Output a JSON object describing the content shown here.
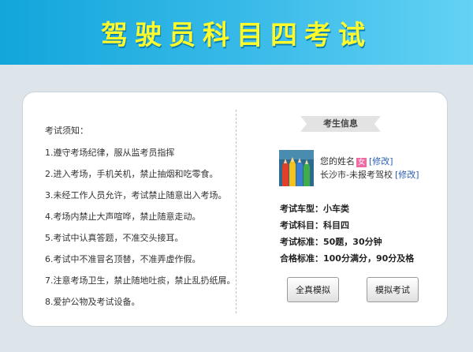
{
  "header": {
    "title": "驾驶员科目四考试"
  },
  "rules": {
    "heading": "考试须知：",
    "items": [
      "1.遵守考场纪律，服从监考员指挥",
      "2.进入考场，手机关机，禁止抽烟和吃零食。",
      "3.未经工作人员允许，考试禁止随意出入考场。",
      "4.考场内禁止大声喧哗，禁止随意走动。",
      "5.考试中认真答题，不准交头接耳。",
      "6.考试中不准冒名顶替，不准弄虚作假。",
      "7.注意考场卫生，禁止随地吐痰，禁止乱扔纸屑。",
      "8.爱护公物及考试设备。"
    ]
  },
  "info": {
    "header": "考生信息",
    "name": "您的姓名",
    "gender": "女",
    "edit_label": "[修改]",
    "school": "长沙市-未报考驾校",
    "school_edit_label": "[修改]",
    "details": [
      "考试车型：小车类",
      "考试科目：科目四",
      "考试标准：50题，30分钟",
      "合格标准：100分满分，90分及格"
    ]
  },
  "buttons": {
    "full": "全真模拟",
    "mock": "模拟考试"
  }
}
